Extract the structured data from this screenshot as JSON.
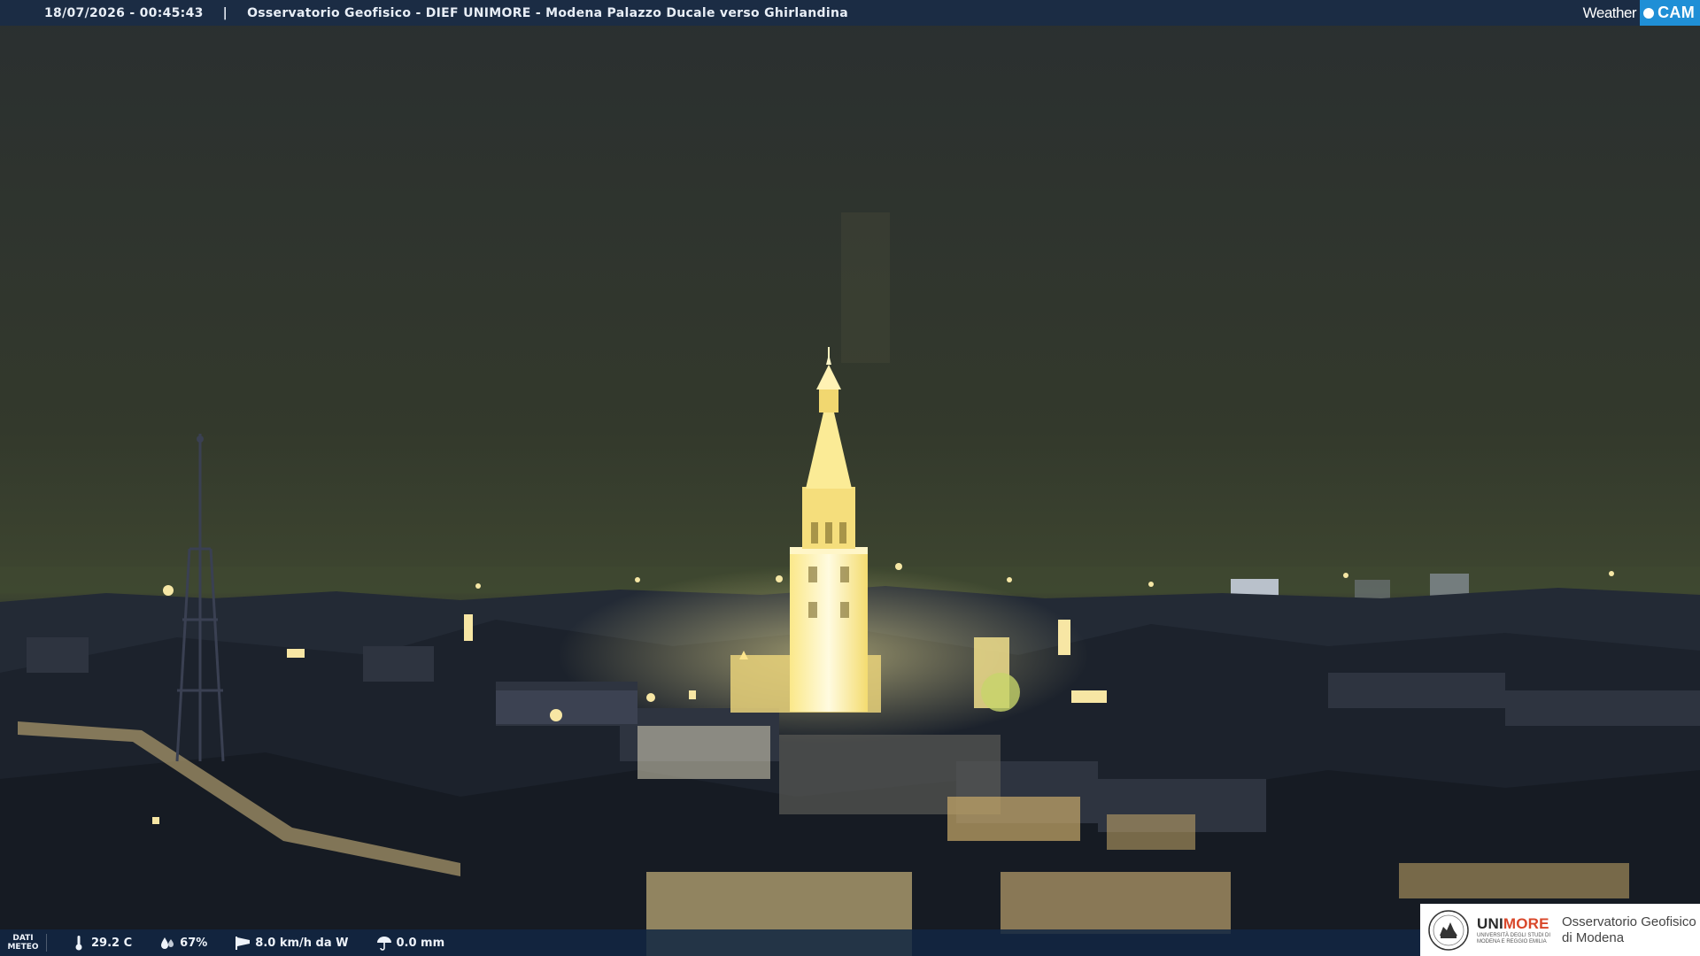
{
  "header": {
    "timestamp": "18/07/2026 - 00:45:43",
    "separator": "|",
    "title": "Osservatorio Geofisico - DIEF UNIMORE - Modena Palazzo Ducale verso Ghirlandina",
    "brand_weather": "Weather",
    "brand_cam": "CAM"
  },
  "meteo": {
    "label_line1": "DATI",
    "label_line2": "METEO",
    "temperature": "29.2 C",
    "humidity": "67%",
    "wind": "8.0 km/h da W",
    "rain": "0.0 mm"
  },
  "logo": {
    "university_part1": "UNI",
    "university_part2": "MORE",
    "university_sub_line1": "UNIVERSITÀ DEGLI STUDI DI",
    "university_sub_line2": "MODENA E REGGIO EMILIA",
    "observatory_line1": "Osservatorio Geofisico",
    "observatory_line2": "di Modena"
  },
  "colors": {
    "sky": "#313a2c",
    "tower": "#fff4b8",
    "city_glow": "#e8c85a",
    "bar": "#1b2c44",
    "accent": "#d9472a"
  }
}
